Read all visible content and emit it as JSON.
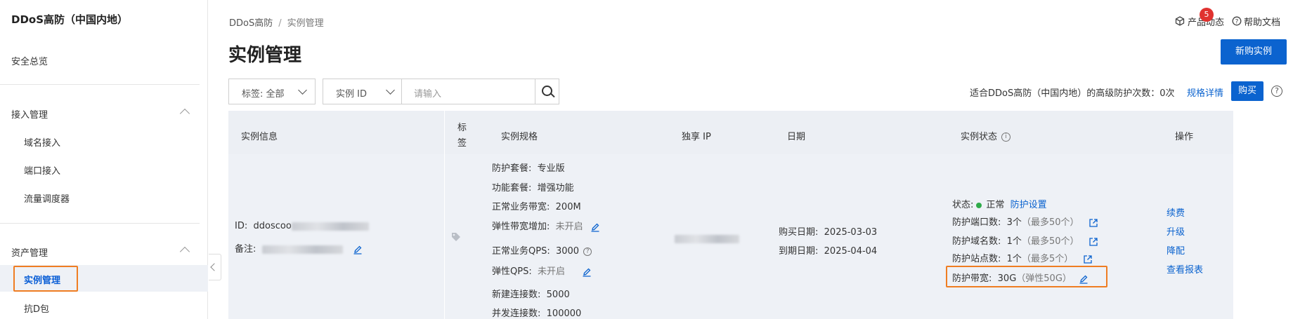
{
  "sidebar": {
    "title": "DDoS高防（中国内地）",
    "overview": "安全总览",
    "groups": [
      {
        "label": "接入管理",
        "items": [
          "域名接入",
          "端口接入",
          "流量调度器"
        ]
      },
      {
        "label": "资产管理",
        "items": [
          "实例管理",
          "抗D包"
        ]
      }
    ],
    "active_item": "实例管理"
  },
  "header": {
    "breadcrumb": [
      "DDoS高防",
      "实例管理"
    ],
    "title": "实例管理",
    "product_news": "产品动态",
    "news_badge": "5",
    "help_docs": "帮助文档",
    "new_button": "新购实例"
  },
  "filters": {
    "tag_select": "标签: 全部",
    "field_select": "实例 ID",
    "search_placeholder": "请输入",
    "quota_text": "适合DDoS高防（中国内地）的高级防护次数：0次",
    "quota_link": "规格详情",
    "buy_button": "购买"
  },
  "table": {
    "headers": [
      "实例信息",
      "标签",
      "实例规格",
      "独享 IP",
      "日期",
      "实例状态",
      "操作"
    ],
    "row": {
      "id_label": "ID:",
      "id_prefix": "ddoscoo",
      "note_label": "备注:",
      "spec": {
        "package_label": "防护套餐:",
        "package": "专业版",
        "feature_label": "功能套餐:",
        "feature": "增强功能",
        "bandwidth_label": "正常业务带宽:",
        "bandwidth": "200M",
        "elastic_label": "弹性带宽增加:",
        "elastic": "未开启",
        "qps_label": "正常业务QPS:",
        "qps": "3000",
        "elastic_qps_label": "弹性QPS:",
        "elastic_qps": "未开启",
        "new_conn_label": "新建连接数:",
        "new_conn": "5000",
        "concurrent_label": "并发连接数:",
        "concurrent": "100000"
      },
      "dates": {
        "buy_label": "购买日期:",
        "buy_date": "2025-03-03",
        "expire_label": "到期日期:",
        "expire_date": "2025-04-04"
      },
      "status": {
        "state_label": "状态:",
        "state": "正常",
        "state_link": "防护设置",
        "ports_label": "防护端口数:",
        "ports": "3个",
        "ports_max": "（最多50个）",
        "domains_label": "防护域名数:",
        "domains": "1个",
        "domains_max": "（最多50个）",
        "sites_label": "防护站点数:",
        "sites": "1个",
        "sites_max": "（最多5个）",
        "bw_label": "防护带宽:",
        "bw": "30G",
        "bw_elastic": "（弹性50G）"
      },
      "actions": [
        "续费",
        "升级",
        "降配",
        "查看报表"
      ]
    }
  },
  "colors": {
    "accent": "#0b63cf",
    "highlight": "#ef7d22",
    "ok": "#2fab4a",
    "badge": "#e0322f"
  }
}
